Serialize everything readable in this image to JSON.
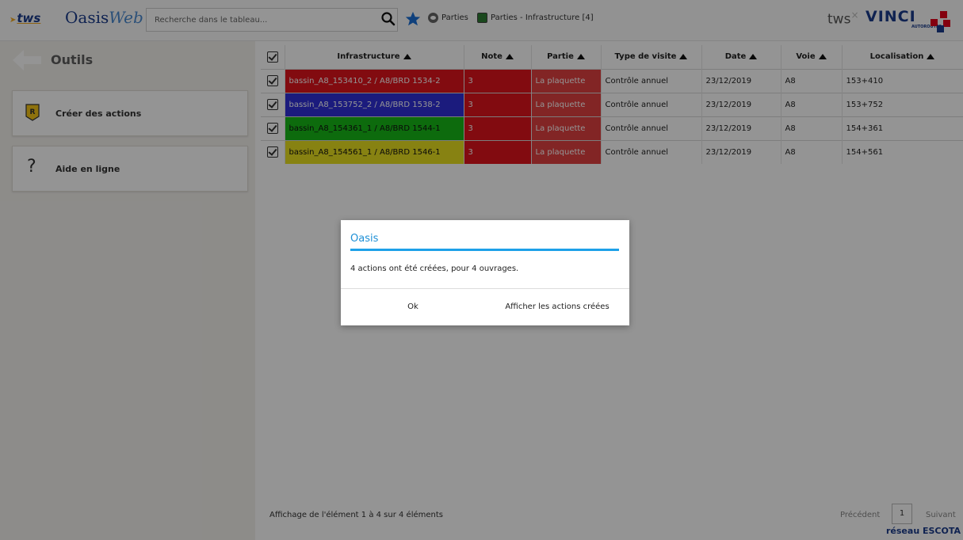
{
  "header": {
    "logo_tws": "tws",
    "logo_oasis": "Oasis",
    "logo_web": "Web",
    "search_placeholder": "Recherche dans le tableau...",
    "breadcrumbs": [
      "Parties",
      "Parties - Infrastructure [4]"
    ],
    "tws_right": "tws",
    "tws_right_mark": "×",
    "vinci": "VINCI",
    "vinci_sub": "AUTOROUTES"
  },
  "sidebar": {
    "title": "Outils",
    "items": [
      {
        "label": "Créer des actions",
        "icon": "action-r-icon"
      },
      {
        "label": "Aide en ligne",
        "icon": "help-icon"
      }
    ]
  },
  "table": {
    "columns": [
      "Infrastructure",
      "Note",
      "Partie",
      "Type de visite",
      "Date",
      "Voie",
      "Localisation"
    ],
    "rows": [
      {
        "infrastructure": "bassin_A8_153410_2 / A8/BRD 1534-2",
        "color": "#e0141c",
        "text_color": "#ffffff",
        "note": "3",
        "partie": "La plaquette",
        "type": "Contrôle annuel",
        "date": "23/12/2019",
        "voie": "A8",
        "localisation": "153+410"
      },
      {
        "infrastructure": "bassin_A8_153752_2 / A8/BRD 1538-2",
        "color": "#3030d8",
        "text_color": "#ffffff",
        "note": "3",
        "partie": "La plaquette",
        "type": "Contrôle annuel",
        "date": "23/12/2019",
        "voie": "A8",
        "localisation": "153+752"
      },
      {
        "infrastructure": "bassin_A8_154361_1 / A8/BRD 1544-1",
        "color": "#18b818",
        "text_color": "#111111",
        "note": "3",
        "partie": "La plaquette",
        "type": "Contrôle annuel",
        "date": "23/12/2019",
        "voie": "A8",
        "localisation": "154+361"
      },
      {
        "infrastructure": "bassin_A8_154561_1 / A8/BRD 1546-1",
        "color": "#e8e020",
        "text_color": "#111111",
        "note": "3",
        "partie": "La plaquette",
        "type": "Contrôle annuel",
        "date": "23/12/2019",
        "voie": "A8",
        "localisation": "154+561"
      }
    ]
  },
  "footer": {
    "summary": "Affichage de l'élément 1 à 4 sur 4 éléments",
    "prev": "Précédent",
    "page": "1",
    "next": "Suivant",
    "network": "réseau ESCOTA"
  },
  "modal": {
    "title": "Oasis",
    "message": "4 actions ont été créées, pour 4 ouvrages.",
    "ok_label": "Ok",
    "show_label": "Afficher les actions créées"
  },
  "colors": {
    "accent": "#1ea1e8",
    "note_red": "#e0141c",
    "brand_blue": "#1a3c8c"
  }
}
